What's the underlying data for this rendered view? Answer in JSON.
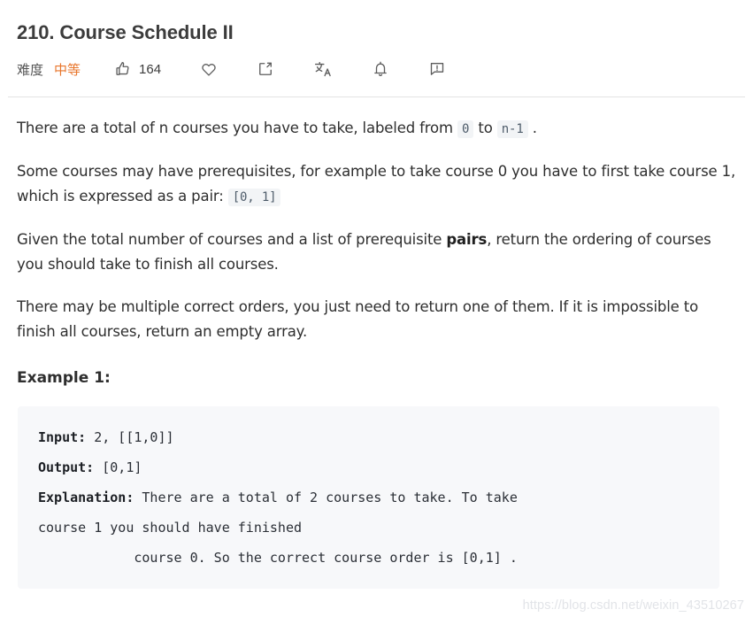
{
  "header": {
    "title": "210. Course Schedule II",
    "difficulty_label": "难度",
    "difficulty_value": "中等",
    "difficulty_color": "#e8762c",
    "vote_count": "164",
    "actions": [
      {
        "name": "thumbs-up-icon",
        "label": "164"
      },
      {
        "name": "heart-icon",
        "label": ""
      },
      {
        "name": "share-icon",
        "label": ""
      },
      {
        "name": "translate-icon",
        "label": ""
      },
      {
        "name": "bell-icon",
        "label": ""
      },
      {
        "name": "report-icon",
        "label": ""
      }
    ]
  },
  "description": {
    "p1_a": "There are a total of n courses you have to take, labeled from ",
    "p1_code1": "0",
    "p1_b": " to ",
    "p1_code2": "n-1",
    "p1_c": " .",
    "p2_a": "Some courses may have prerequisites, for example to take course 0 you have to first take course 1, which is expressed as a pair: ",
    "p2_code1": "[0, 1]",
    "p3_a": "Given the total number of courses and a list of prerequisite ",
    "p3_bold": "pairs",
    "p3_b": ", return the ordering of courses you should take to finish all courses.",
    "p4": "There may be multiple correct orders, you just need to return one of them. If it is impossible to finish all courses, return an empty array."
  },
  "example": {
    "heading": "Example 1:",
    "lines": [
      {
        "label": "Input:",
        "text": " 2, [[1,0]]"
      },
      {
        "label": "Output:",
        "text": " [0,1]"
      },
      {
        "label": "Explanation:",
        "text": " There are a total of 2 courses to take. To take"
      },
      {
        "label": "",
        "text": "course 1 you should have finished"
      },
      {
        "label": "",
        "text": "            course 0. So the correct course order is [0,1] ."
      }
    ]
  },
  "watermark": {
    "text": "https://blog.csdn.net/weixin_43510267"
  }
}
